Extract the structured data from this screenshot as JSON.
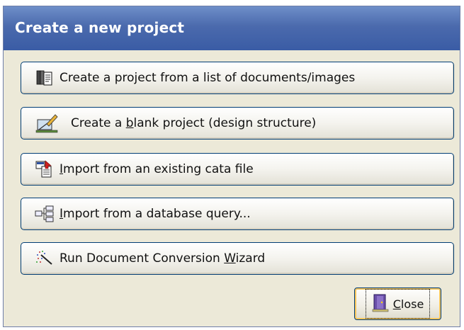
{
  "dialog": {
    "title": "Create a new project",
    "buttons": [
      {
        "id": "from-list",
        "prefix": "Create a project from a list of documents/images",
        "underline": "",
        "suffix": "",
        "icon": "documents-stack-icon"
      },
      {
        "id": "blank",
        "prefix": "Create a ",
        "underline": "b",
        "suffix": "lank project (design structure)",
        "icon": "design-ruler-pencil-icon"
      },
      {
        "id": "import-cata",
        "prefix": "",
        "underline": "I",
        "suffix": "mport from an existing cata file",
        "icon": "import-file-icon"
      },
      {
        "id": "import-db",
        "prefix": "",
        "underline": "I",
        "suffix": "mport from a database query...",
        "icon": "database-tree-icon"
      },
      {
        "id": "wizard",
        "prefix": "Run Document Conversion ",
        "underline": "W",
        "suffix": "izard",
        "icon": "magic-wand-icon"
      }
    ],
    "close": {
      "prefix": "",
      "underline": "C",
      "suffix": "lose",
      "icon": "door-exit-icon"
    }
  }
}
